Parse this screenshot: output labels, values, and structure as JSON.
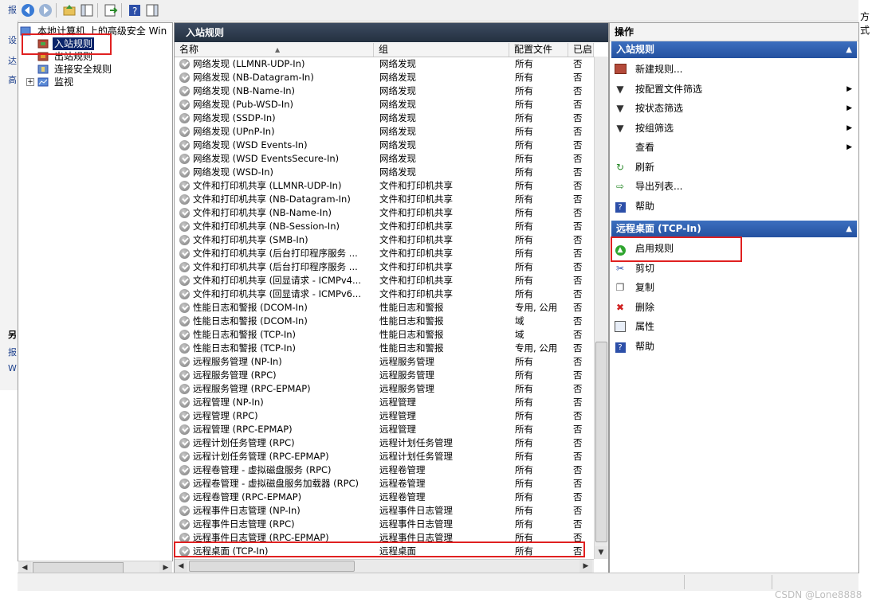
{
  "outer": {
    "left_glyphs": [
      "报",
      "设",
      "达",
      "高",
      "另",
      "报",
      "W"
    ],
    "right_text": "方式"
  },
  "tree": {
    "root": "本地计算机 上的高级安全 Win",
    "items": [
      {
        "label": "入站规则",
        "selected": true
      },
      {
        "label": "出站规则",
        "selected": false
      },
      {
        "label": "连接安全规则",
        "selected": false
      },
      {
        "label": "监视",
        "selected": false,
        "expander": "+"
      }
    ]
  },
  "center": {
    "title": "入站规则",
    "columns": [
      "名称",
      "组",
      "配置文件",
      "已启"
    ],
    "rows": [
      {
        "name": "网络发现 (LLMNR-UDP-In)",
        "group": "网络发现",
        "profile": "所有",
        "enabled": "否"
      },
      {
        "name": "网络发现 (NB-Datagram-In)",
        "group": "网络发现",
        "profile": "所有",
        "enabled": "否"
      },
      {
        "name": "网络发现 (NB-Name-In)",
        "group": "网络发现",
        "profile": "所有",
        "enabled": "否"
      },
      {
        "name": "网络发现 (Pub-WSD-In)",
        "group": "网络发现",
        "profile": "所有",
        "enabled": "否"
      },
      {
        "name": "网络发现 (SSDP-In)",
        "group": "网络发现",
        "profile": "所有",
        "enabled": "否"
      },
      {
        "name": "网络发现 (UPnP-In)",
        "group": "网络发现",
        "profile": "所有",
        "enabled": "否"
      },
      {
        "name": "网络发现 (WSD Events-In)",
        "group": "网络发现",
        "profile": "所有",
        "enabled": "否"
      },
      {
        "name": "网络发现 (WSD EventsSecure-In)",
        "group": "网络发现",
        "profile": "所有",
        "enabled": "否"
      },
      {
        "name": "网络发现 (WSD-In)",
        "group": "网络发现",
        "profile": "所有",
        "enabled": "否"
      },
      {
        "name": "文件和打印机共享 (LLMNR-UDP-In)",
        "group": "文件和打印机共享",
        "profile": "所有",
        "enabled": "否"
      },
      {
        "name": "文件和打印机共享 (NB-Datagram-In)",
        "group": "文件和打印机共享",
        "profile": "所有",
        "enabled": "否"
      },
      {
        "name": "文件和打印机共享 (NB-Name-In)",
        "group": "文件和打印机共享",
        "profile": "所有",
        "enabled": "否"
      },
      {
        "name": "文件和打印机共享 (NB-Session-In)",
        "group": "文件和打印机共享",
        "profile": "所有",
        "enabled": "否"
      },
      {
        "name": "文件和打印机共享 (SMB-In)",
        "group": "文件和打印机共享",
        "profile": "所有",
        "enabled": "否"
      },
      {
        "name": "文件和打印机共享 (后台打印程序服务 ...",
        "group": "文件和打印机共享",
        "profile": "所有",
        "enabled": "否"
      },
      {
        "name": "文件和打印机共享 (后台打印程序服务 ...",
        "group": "文件和打印机共享",
        "profile": "所有",
        "enabled": "否"
      },
      {
        "name": "文件和打印机共享 (回显请求 - ICMPv4...",
        "group": "文件和打印机共享",
        "profile": "所有",
        "enabled": "否"
      },
      {
        "name": "文件和打印机共享 (回显请求 - ICMPv6...",
        "group": "文件和打印机共享",
        "profile": "所有",
        "enabled": "否"
      },
      {
        "name": "性能日志和警报 (DCOM-In)",
        "group": "性能日志和警报",
        "profile": "专用, 公用",
        "enabled": "否"
      },
      {
        "name": "性能日志和警报 (DCOM-In)",
        "group": "性能日志和警报",
        "profile": "域",
        "enabled": "否"
      },
      {
        "name": "性能日志和警报 (TCP-In)",
        "group": "性能日志和警报",
        "profile": "域",
        "enabled": "否"
      },
      {
        "name": "性能日志和警报 (TCP-In)",
        "group": "性能日志和警报",
        "profile": "专用, 公用",
        "enabled": "否"
      },
      {
        "name": "远程服务管理 (NP-In)",
        "group": "远程服务管理",
        "profile": "所有",
        "enabled": "否"
      },
      {
        "name": "远程服务管理 (RPC)",
        "group": "远程服务管理",
        "profile": "所有",
        "enabled": "否"
      },
      {
        "name": "远程服务管理 (RPC-EPMAP)",
        "group": "远程服务管理",
        "profile": "所有",
        "enabled": "否"
      },
      {
        "name": "远程管理 (NP-In)",
        "group": "远程管理",
        "profile": "所有",
        "enabled": "否"
      },
      {
        "name": "远程管理 (RPC)",
        "group": "远程管理",
        "profile": "所有",
        "enabled": "否"
      },
      {
        "name": "远程管理 (RPC-EPMAP)",
        "group": "远程管理",
        "profile": "所有",
        "enabled": "否"
      },
      {
        "name": "远程计划任务管理 (RPC)",
        "group": "远程计划任务管理",
        "profile": "所有",
        "enabled": "否"
      },
      {
        "name": "远程计划任务管理 (RPC-EPMAP)",
        "group": "远程计划任务管理",
        "profile": "所有",
        "enabled": "否"
      },
      {
        "name": "远程卷管理 - 虚拟磁盘服务 (RPC)",
        "group": "远程卷管理",
        "profile": "所有",
        "enabled": "否"
      },
      {
        "name": "远程卷管理 - 虚拟磁盘服务加载器 (RPC)",
        "group": "远程卷管理",
        "profile": "所有",
        "enabled": "否"
      },
      {
        "name": "远程卷管理 (RPC-EPMAP)",
        "group": "远程卷管理",
        "profile": "所有",
        "enabled": "否"
      },
      {
        "name": "远程事件日志管理 (NP-In)",
        "group": "远程事件日志管理",
        "profile": "所有",
        "enabled": "否"
      },
      {
        "name": "远程事件日志管理 (RPC)",
        "group": "远程事件日志管理",
        "profile": "所有",
        "enabled": "否"
      },
      {
        "name": "远程事件日志管理 (RPC-EPMAP)",
        "group": "远程事件日志管理",
        "profile": "所有",
        "enabled": "否"
      },
      {
        "name": "远程桌面 (TCP-In)",
        "group": "远程桌面",
        "profile": "所有",
        "enabled": "否"
      }
    ]
  },
  "actions": {
    "title": "操作",
    "section1": {
      "header": "入站规则",
      "items": [
        {
          "label": "新建规则...",
          "icon": "new-rule-icon",
          "submenu": false
        },
        {
          "label": "按配置文件筛选",
          "icon": "filter-icon",
          "submenu": true
        },
        {
          "label": "按状态筛选",
          "icon": "filter-icon",
          "submenu": true
        },
        {
          "label": "按组筛选",
          "icon": "filter-icon",
          "submenu": true
        },
        {
          "label": "查看",
          "icon": "",
          "submenu": true
        },
        {
          "label": "刷新",
          "icon": "refresh-icon",
          "submenu": false
        },
        {
          "label": "导出列表...",
          "icon": "export-icon",
          "submenu": false
        },
        {
          "label": "帮助",
          "icon": "help-icon",
          "submenu": false
        }
      ]
    },
    "section2": {
      "header": "远程桌面 (TCP-In)",
      "items": [
        {
          "label": "启用规则",
          "icon": "enable-rule-icon"
        },
        {
          "label": "剪切",
          "icon": "cut-icon"
        },
        {
          "label": "复制",
          "icon": "copy-icon"
        },
        {
          "label": "删除",
          "icon": "delete-icon"
        },
        {
          "label": "属性",
          "icon": "properties-icon"
        },
        {
          "label": "帮助",
          "icon": "help-icon"
        }
      ]
    }
  },
  "colors": {
    "header_dark": "#2c3848",
    "section_blue": "#2f5fae",
    "highlight_red": "#e02020",
    "selection": "#0a246a"
  },
  "watermark": "CSDN @Lone8888"
}
